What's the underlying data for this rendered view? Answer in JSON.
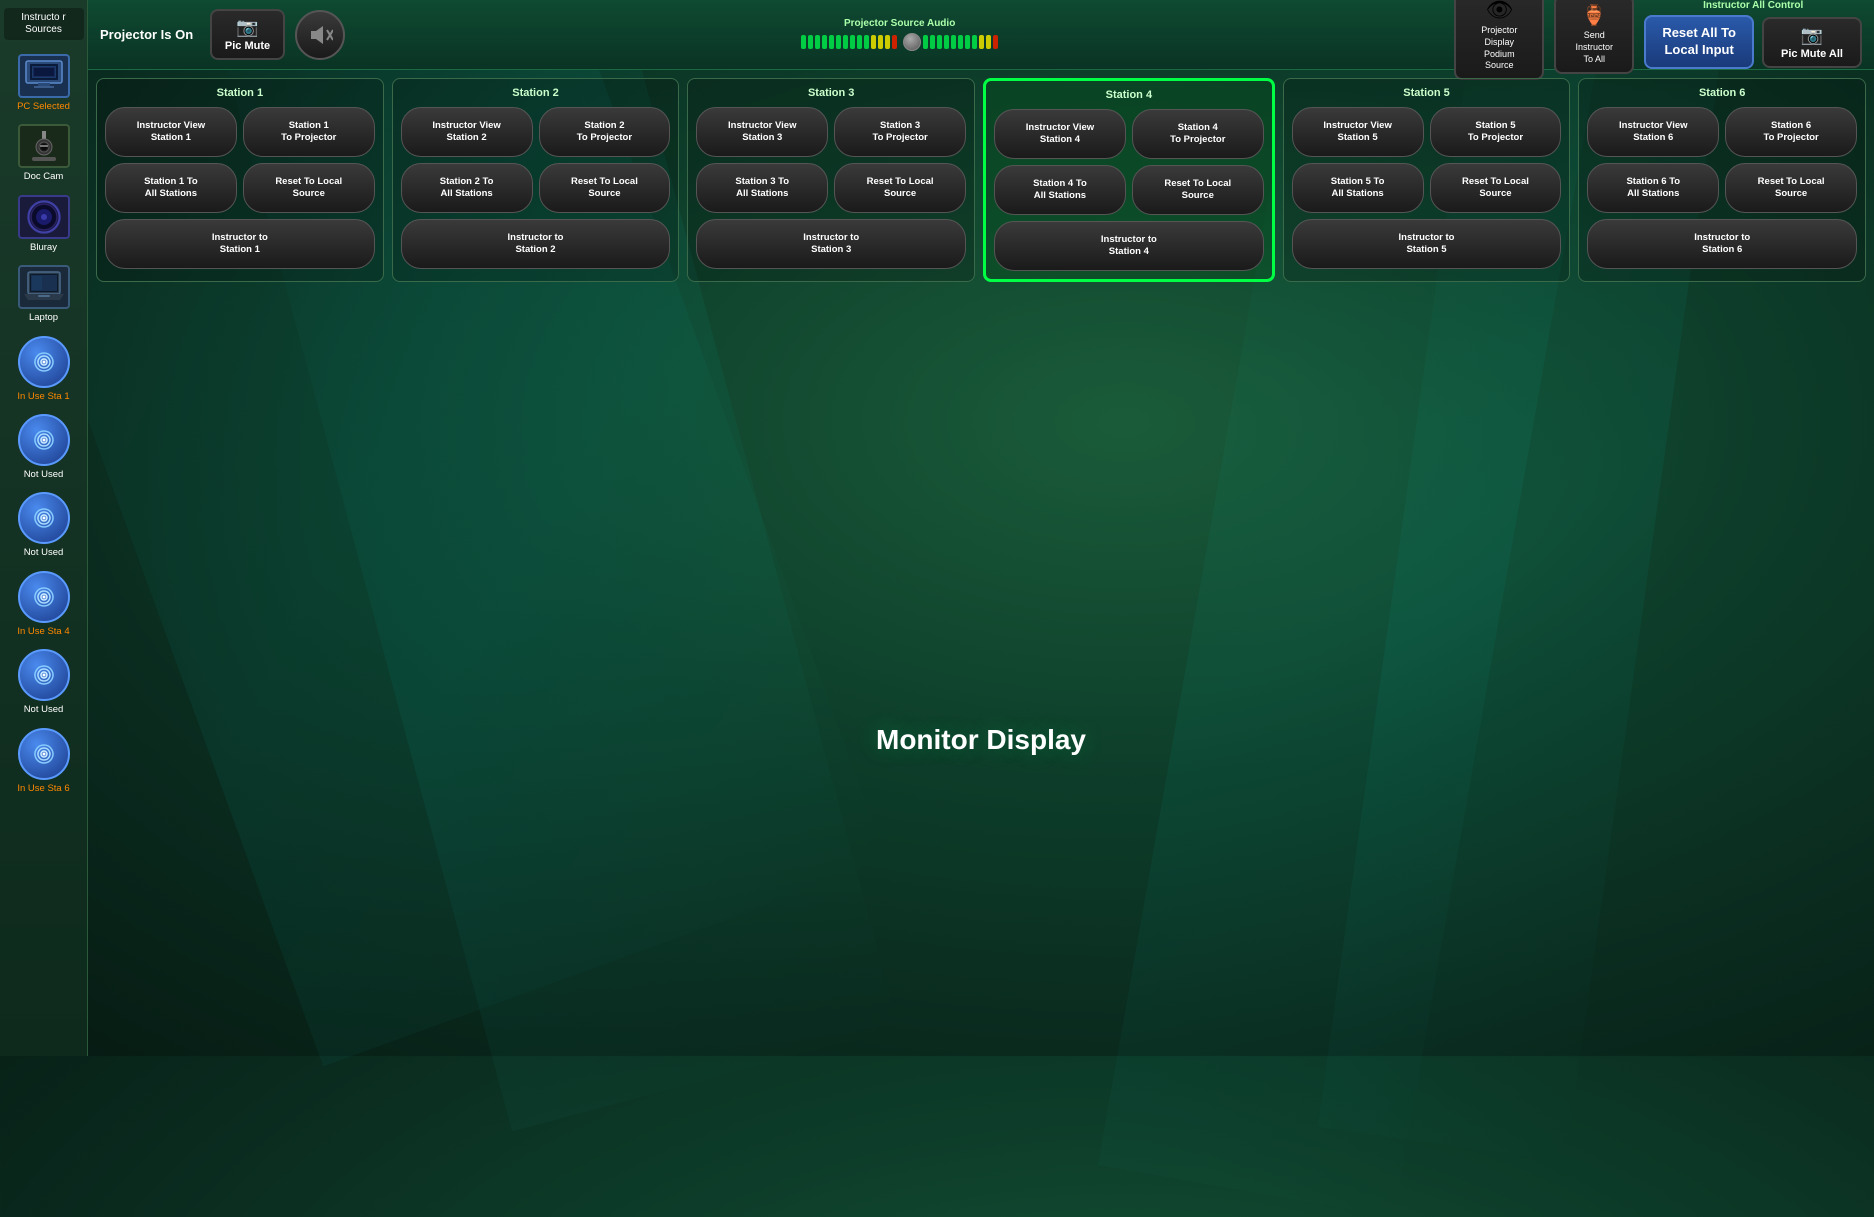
{
  "sidebar": {
    "header": "Instructo\nr Sources",
    "items": [
      {
        "id": "pc",
        "label": "PC Selected",
        "label_color": "orange",
        "icon": "pc"
      },
      {
        "id": "doccam",
        "label": "Doc Cam",
        "label_color": "white",
        "icon": "doccam"
      },
      {
        "id": "bluray",
        "label": "Bluray",
        "label_color": "white",
        "icon": "bluray"
      },
      {
        "id": "laptop",
        "label": "Laptop",
        "label_color": "white",
        "icon": "laptop"
      },
      {
        "id": "sta1",
        "label": "In Use Sta 1",
        "label_color": "orange",
        "icon": "spiral"
      },
      {
        "id": "sta2",
        "label": "Not Used",
        "label_color": "white",
        "icon": "spiral"
      },
      {
        "id": "sta3",
        "label": "Not Used",
        "label_color": "white",
        "icon": "spiral"
      },
      {
        "id": "sta4",
        "label": "In Use Sta 4",
        "label_color": "orange",
        "icon": "spiral"
      },
      {
        "id": "sta5",
        "label": "Not Used",
        "label_color": "white",
        "icon": "spiral"
      },
      {
        "id": "sta6",
        "label": "In Use Sta 6",
        "label_color": "orange",
        "icon": "spiral"
      }
    ]
  },
  "topbar": {
    "projector_status": "Projector Is On",
    "pic_mute": "Pic Mute",
    "audio_label": "Projector Source Audio",
    "projector_display_podium_source": "Projector\nDisplay\nPodium\nSource",
    "send_instructor_to_all": "Send\nInstructor\nTo All",
    "instructor_all_control": "Instructor All\nControl",
    "reset_all_local_input": "Reset All To\nLocal Input",
    "pic_mute_all": "Pic Mute All"
  },
  "stations": [
    {
      "id": "station1",
      "header": "Station 1",
      "active": false,
      "buttons": [
        {
          "label": "Instructor View\nStation 1",
          "full": false
        },
        {
          "label": "Station 1\nTo Projector",
          "full": false
        },
        {
          "label": "Station 1 To\nAll Stations",
          "full": false
        },
        {
          "label": "Reset To Local\nSource",
          "full": false
        },
        {
          "label": "Instructor to\nStation 1",
          "full": true
        }
      ]
    },
    {
      "id": "station2",
      "header": "Station 2",
      "active": false,
      "buttons": [
        {
          "label": "Instructor View\nStation 2",
          "full": false
        },
        {
          "label": "Station 2\nTo Projector",
          "full": false
        },
        {
          "label": "Station 2 To\nAll Stations",
          "full": false
        },
        {
          "label": "Reset To Local\nSource",
          "full": false
        },
        {
          "label": "Instructor to\nStation 2",
          "full": true
        }
      ]
    },
    {
      "id": "station3",
      "header": "Station 3",
      "active": false,
      "buttons": [
        {
          "label": "Instructor View\nStation 3",
          "full": false
        },
        {
          "label": "Station 3\nTo Projector",
          "full": false
        },
        {
          "label": "Station 3 To\nAll Stations",
          "full": false
        },
        {
          "label": "Reset To Local\nSource",
          "full": false
        },
        {
          "label": "Instructor to\nStation 3",
          "full": true
        }
      ]
    },
    {
      "id": "station4",
      "header": "Station 4",
      "active": true,
      "buttons": [
        {
          "label": "Instructor View\nStation 4",
          "full": false
        },
        {
          "label": "Station 4\nTo Projector",
          "full": false
        },
        {
          "label": "Station 4 To\nAll Stations",
          "full": false
        },
        {
          "label": "Reset To Local\nSource",
          "full": false
        },
        {
          "label": "Instructor to\nStation 4",
          "full": true
        }
      ]
    },
    {
      "id": "station5",
      "header": "Station 5",
      "active": false,
      "buttons": [
        {
          "label": "Instructor View\nStation 5",
          "full": false
        },
        {
          "label": "Station 5\nTo Projector",
          "full": false
        },
        {
          "label": "Station 5 To\nAll Stations",
          "full": false
        },
        {
          "label": "Reset To Local\nSource",
          "full": false
        },
        {
          "label": "Instructor to\nStation 5",
          "full": true
        }
      ]
    },
    {
      "id": "station6",
      "header": "Station 6",
      "active": false,
      "buttons": [
        {
          "label": "Instructor View\nStation 6",
          "full": false
        },
        {
          "label": "Station 6\nTo Projector",
          "full": false
        },
        {
          "label": "Station 6 To\nAll Stations",
          "full": false
        },
        {
          "label": "Reset To Local\nSource",
          "full": false
        },
        {
          "label": "Instructor to\nStation 6",
          "full": true
        }
      ]
    }
  ],
  "monitor_display": "Monitor Display"
}
